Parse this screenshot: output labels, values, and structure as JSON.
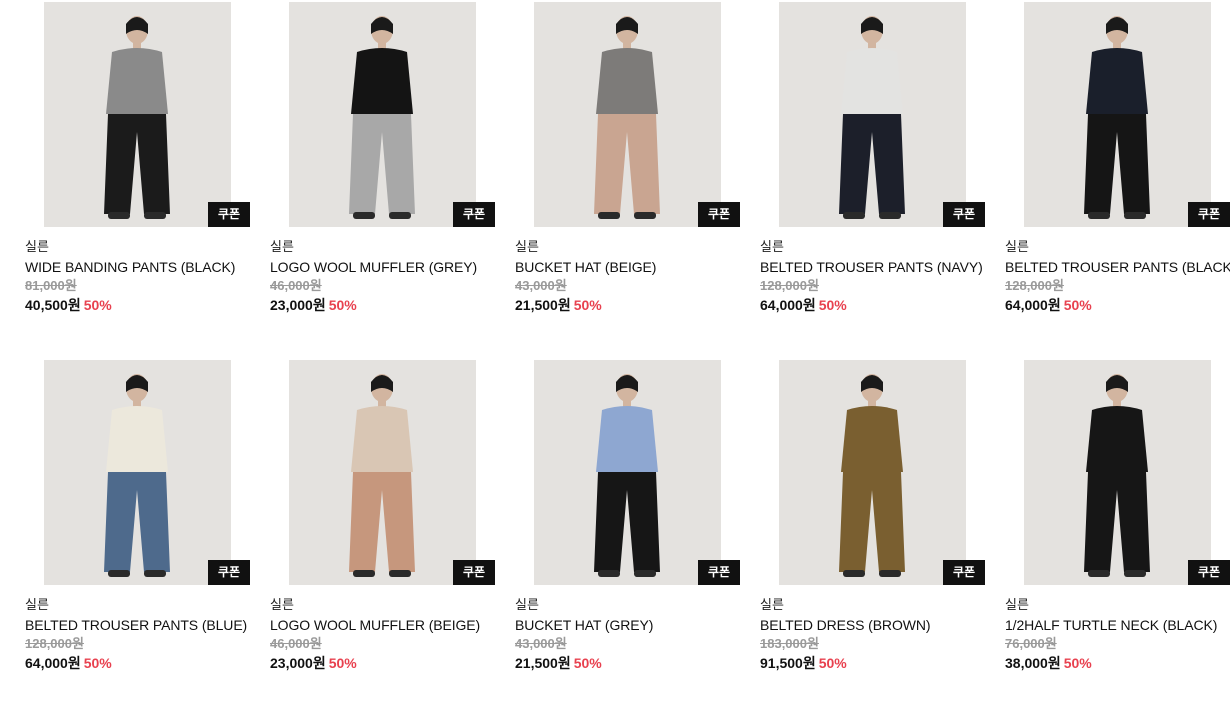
{
  "products": [
    {
      "brand": "실른",
      "name": "WIDE BANDING PANTS (BLACK)",
      "original_price": "81,000원",
      "sale_price": "40,500원",
      "discount": "50%",
      "badge": "쿠폰",
      "colors": {
        "top": "#8a8a8a",
        "bottom": "#1b1b1b"
      }
    },
    {
      "brand": "실른",
      "name": "LOGO WOOL MUFFLER (GREY)",
      "original_price": "46,000원",
      "sale_price": "23,000원",
      "discount": "50%",
      "badge": "쿠폰",
      "colors": {
        "top": "#141414",
        "bottom": "#a8a8a8"
      }
    },
    {
      "brand": "실른",
      "name": "BUCKET HAT (BEIGE)",
      "original_price": "43,000원",
      "sale_price": "21,500원",
      "discount": "50%",
      "badge": "쿠폰",
      "colors": {
        "top": "#7d7b79",
        "bottom": "#c9a591"
      }
    },
    {
      "brand": "실른",
      "name": "BELTED TROUSER PANTS (NAVY)",
      "original_price": "128,000원",
      "sale_price": "64,000원",
      "discount": "50%",
      "badge": "쿠폰",
      "colors": {
        "top": "#e3e3e1",
        "bottom": "#1c1f2a"
      }
    },
    {
      "brand": "실른",
      "name": "BELTED TROUSER PANTS (BLACK)",
      "original_price": "128,000원",
      "sale_price": "64,000원",
      "discount": "50%",
      "badge": "쿠폰",
      "colors": {
        "top": "#1a1f2b",
        "bottom": "#151515"
      }
    },
    {
      "brand": "실른",
      "name": "BELTED TROUSER PANTS (BLUE)",
      "original_price": "128,000원",
      "sale_price": "64,000원",
      "discount": "50%",
      "badge": "쿠폰",
      "colors": {
        "top": "#ece8dc",
        "bottom": "#4e6a8c"
      }
    },
    {
      "brand": "실른",
      "name": "LOGO WOOL MUFFLER (BEIGE)",
      "original_price": "46,000원",
      "sale_price": "23,000원",
      "discount": "50%",
      "badge": "쿠폰",
      "colors": {
        "top": "#d9c6b4",
        "bottom": "#c6977d"
      }
    },
    {
      "brand": "실른",
      "name": "BUCKET HAT (GREY)",
      "original_price": "43,000원",
      "sale_price": "21,500원",
      "discount": "50%",
      "badge": "쿠폰",
      "colors": {
        "top": "#8ea7d1",
        "bottom": "#161616"
      }
    },
    {
      "brand": "실른",
      "name": "BELTED DRESS (BROWN)",
      "original_price": "183,000원",
      "sale_price": "91,500원",
      "discount": "50%",
      "badge": "쿠폰",
      "colors": {
        "top": "#7a5f30",
        "bottom": "#7a5f30"
      }
    },
    {
      "brand": "실른",
      "name": "1/2HALF TURTLE NECK (BLACK)",
      "original_price": "76,000원",
      "sale_price": "38,000원",
      "discount": "50%",
      "badge": "쿠폰",
      "colors": {
        "top": "#161616",
        "bottom": "#161616"
      }
    }
  ]
}
